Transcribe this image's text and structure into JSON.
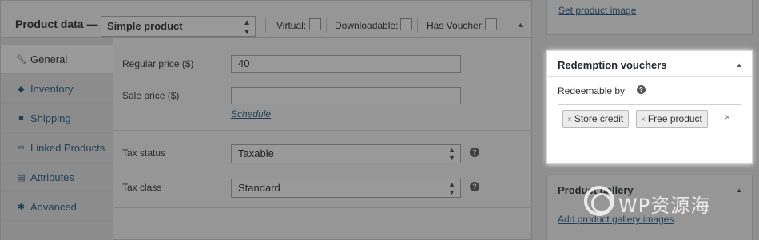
{
  "product_data": {
    "title": "Product data —",
    "product_type": "Simple product",
    "virtual_label": "Virtual:",
    "downloadable_label": "Downloadable:",
    "has_voucher_label": "Has Voucher:",
    "virtual_checked": false,
    "downloadable_checked": false,
    "has_voucher_checked": false
  },
  "tabs": [
    {
      "label": "General",
      "icon": "wrench-icon",
      "active": true
    },
    {
      "label": "Inventory",
      "icon": "inventory-icon",
      "active": false
    },
    {
      "label": "Shipping",
      "icon": "truck-icon",
      "active": false
    },
    {
      "label": "Linked Products",
      "icon": "link-icon",
      "active": false
    },
    {
      "label": "Attributes",
      "icon": "list-icon",
      "active": false
    },
    {
      "label": "Advanced",
      "icon": "gear-icon",
      "active": false
    }
  ],
  "general": {
    "regular_price_label": "Regular price ($)",
    "regular_price_value": "40",
    "sale_price_label": "Sale price ($)",
    "sale_price_value": "",
    "schedule_link": "Schedule",
    "tax_status_label": "Tax status",
    "tax_status_value": "Taxable",
    "tax_class_label": "Tax class",
    "tax_class_value": "Standard"
  },
  "sidebar": {
    "set_product_image": "Set product image",
    "redemption": {
      "title": "Redemption vouchers",
      "redeemable_by_label": "Redeemable by",
      "tokens": [
        "Store credit",
        "Free product"
      ],
      "clear_symbol": "×"
    },
    "gallery": {
      "title": "Product gallery",
      "add_link": "Add product gallery images"
    }
  },
  "watermark": "WP资源海",
  "colors": {
    "overlay_gray": "#969696",
    "link_blue": "#1f3f55",
    "highlight_box": "#ffffff"
  }
}
